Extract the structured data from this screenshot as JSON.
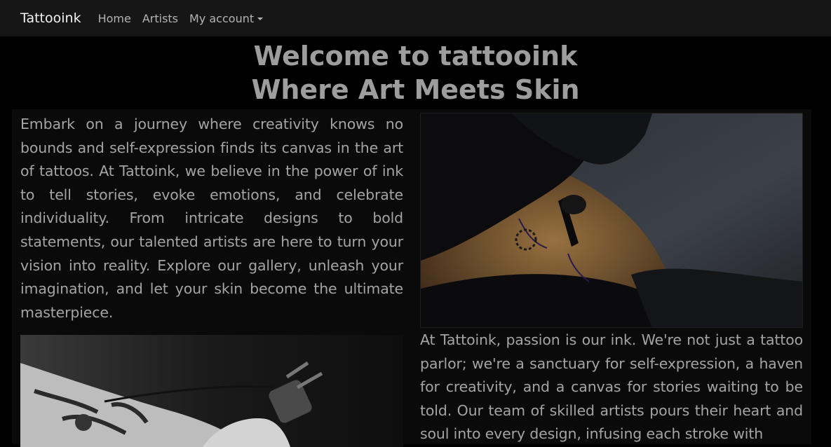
{
  "navbar": {
    "brand": "Tattooink",
    "links": [
      {
        "label": "Home"
      },
      {
        "label": "Artists"
      },
      {
        "label": "My account",
        "dropdown": true
      }
    ]
  },
  "hero": {
    "line1": "Welcome to tattooink",
    "line2": "Where Art Meets Skin"
  },
  "content": {
    "intro": "Embark on a journey where creativity knows no bounds and self-expression finds its canvas in the art of tattoos. At Tattoink, we believe in the power of ink to tell stories, evoke emotions, and celebrate individuality. From intricate designs to bold statements, our talented artists are here to turn your vision into reality. Explore our gallery, unleash your imagination, and let your skin become the ultimate masterpiece.",
    "about": "At Tattoink, passion is our ink. We're not just a tattoo parlor; we're a sanctuary for self-expression, a haven for creativity, and a canvas for stories waiting to be told. Our team of skilled artists pours their heart and soul into every design, infusing each stroke with"
  },
  "colors": {
    "navbar_bg": "#161616",
    "page_bg": "#000000",
    "content_bg": "#0a0a0a",
    "text": "#a4a4a4"
  }
}
